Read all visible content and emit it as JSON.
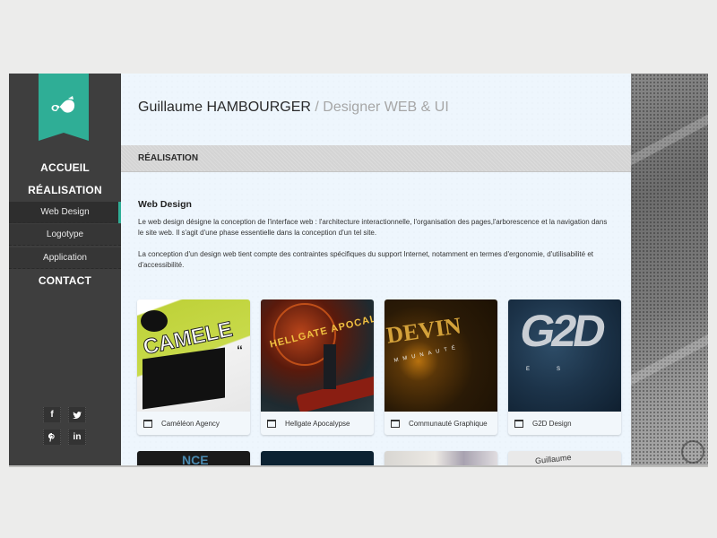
{
  "sidebar": {
    "logo_icon": "swirl-logo-icon",
    "nav": [
      {
        "label": "ACCUEIL"
      },
      {
        "label": "RÉALISATION"
      },
      {
        "label": "CONTACT"
      }
    ],
    "subnav": [
      {
        "label": "Web Design",
        "active": true
      },
      {
        "label": "Logotype",
        "active": false
      },
      {
        "label": "Application",
        "active": false
      }
    ],
    "social": [
      {
        "name": "facebook",
        "glyph": "f"
      },
      {
        "name": "twitter",
        "glyph": "🐦"
      },
      {
        "name": "pinterest",
        "glyph": "℗"
      },
      {
        "name": "linkedin",
        "glyph": "in"
      }
    ]
  },
  "header": {
    "name": "Guillaume HAMBOURGER",
    "separator": " / ",
    "role": "Designer WEB & UI"
  },
  "section": {
    "title": "RÉALISATION"
  },
  "content": {
    "heading": "Web Design",
    "paragraphs": [
      "Le web design désigne la conception de l'interface web : l'architecture interactionnelle, l'organisation des pages,l'arborescence et la navigation dans le site web. Il s'agit d'une phase essentielle dans la conception d'un tel site.",
      "La conception d'un design web tient compte des contraintes spécifiques du support Internet, notamment en termes d'ergonomie, d'utilisabilité et d'accessibilité."
    ]
  },
  "projects": [
    {
      "title": "Caméléon Agency",
      "thumb_text": "CAMELE"
    },
    {
      "title": "Hellgate Apocalypse",
      "thumb_text": "HELLGATE APOCALYPSE"
    },
    {
      "title": "Communauté Graphique",
      "thumb_text": "DEVIN"
    },
    {
      "title": "G2D Design",
      "thumb_text": "G2D"
    }
  ],
  "projects_partial": [
    {
      "thumb_text": "NCE"
    },
    {
      "thumb_text": ""
    },
    {
      "thumb_text": ""
    },
    {
      "thumb_text": "Guillaume"
    }
  ],
  "colors": {
    "accent": "#2fae96",
    "sidebar": "#3e3e3e",
    "main_bg": "#eef6fd"
  }
}
